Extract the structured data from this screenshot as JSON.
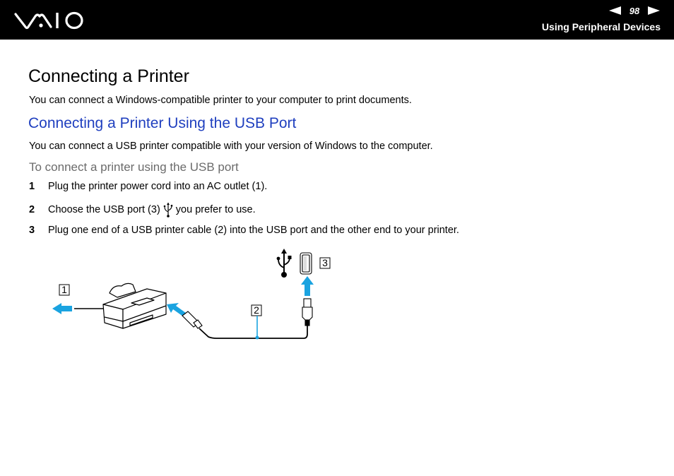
{
  "header": {
    "logo": "VAIO",
    "page_number": "98",
    "prev_page_icon": "triangle-left-icon",
    "next_page_icon": "triangle-right-icon",
    "section": "Using Peripheral Devices"
  },
  "content": {
    "title": "Connecting a Printer",
    "intro": "You can connect a Windows-compatible printer to your computer to print documents.",
    "subtitle": "Connecting a Printer Using the USB Port",
    "subtitle_color": "#1f3fbf",
    "sub_intro": "You can connect a USB printer compatible with your version of Windows to the computer.",
    "procedure_title": "To connect a printer using the USB port",
    "steps": [
      {
        "num": "1",
        "text": "Plug the printer power cord into an AC outlet (1)."
      },
      {
        "num": "2",
        "text_before": "Choose the USB port (3)",
        "icon": "usb-icon",
        "text_after": "you prefer to use."
      },
      {
        "num": "3",
        "text": "Plug one end of a USB printer cable (2) into the USB port and the other end to your printer."
      }
    ]
  },
  "diagram": {
    "callouts": [
      "1",
      "2",
      "3"
    ],
    "arrow_color": "#1aa3e0",
    "parts": [
      "ac-outlet-arrow",
      "printer",
      "usb-printer-cable",
      "usb-port",
      "usb-symbol"
    ]
  }
}
